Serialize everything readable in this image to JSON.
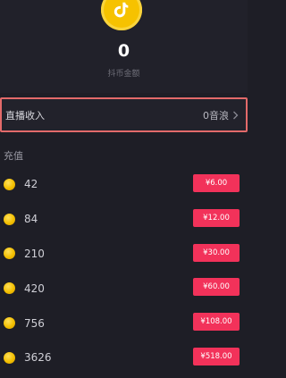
{
  "wallet": {
    "balance": "0",
    "balance_label": "抖币金额"
  },
  "income": {
    "label": "直播收入",
    "value": "0音浪"
  },
  "recharge": {
    "title": "充值",
    "items": [
      {
        "amount": "42",
        "price": "¥6.00"
      },
      {
        "amount": "84",
        "price": "¥12.00"
      },
      {
        "amount": "210",
        "price": "¥30.00"
      },
      {
        "amount": "420",
        "price": "¥60.00"
      },
      {
        "amount": "756",
        "price": "¥108.00"
      },
      {
        "amount": "3626",
        "price": "¥518.00"
      }
    ]
  },
  "colors": {
    "accent": "#f2325a",
    "coin": "#f6c200",
    "highlight_border": "#e36a6a",
    "background": "#1e1e26"
  },
  "icons": {
    "logo": "tiktok-coin-icon",
    "chevron": "chevron-right-icon",
    "coin": "coin-icon"
  }
}
